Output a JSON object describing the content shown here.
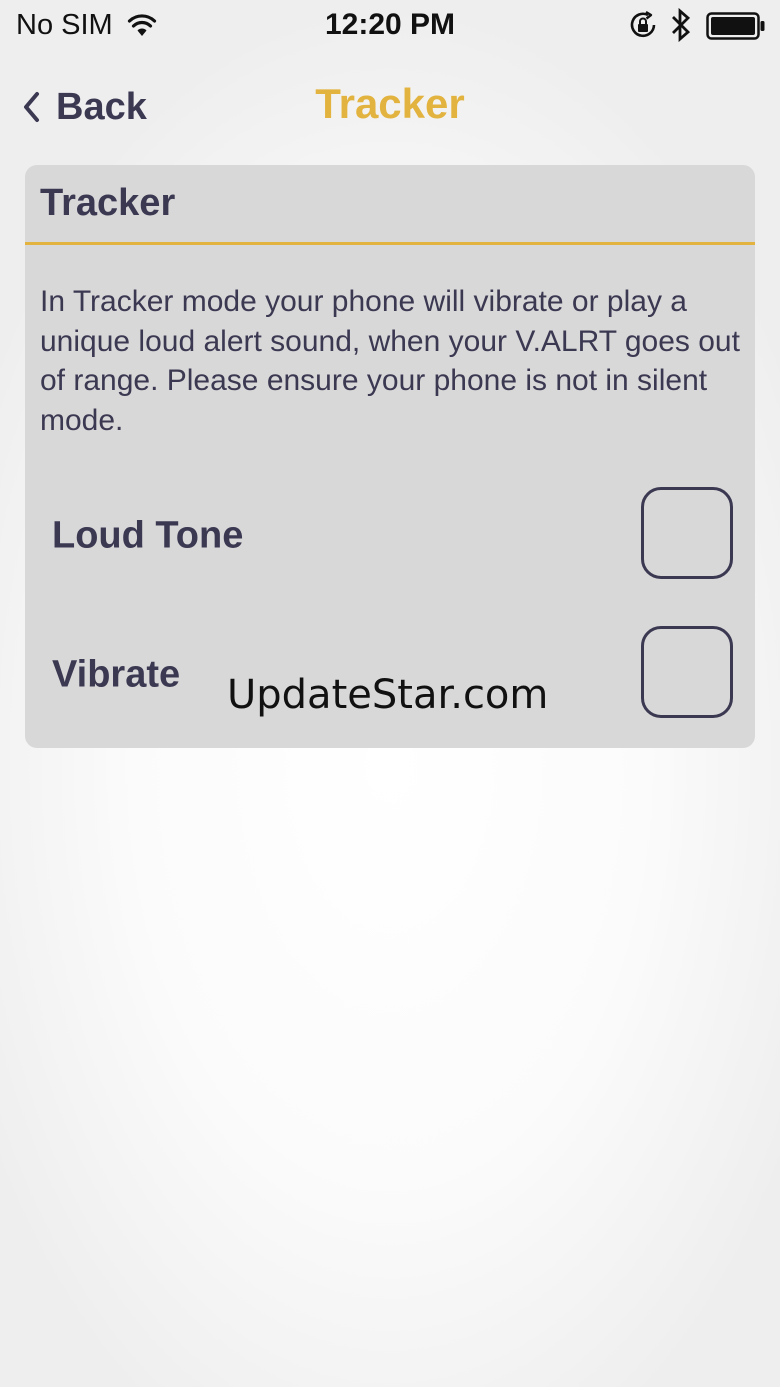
{
  "status_bar": {
    "carrier": "No SIM",
    "time": "12:20 PM"
  },
  "nav": {
    "back_label": "Back",
    "title": "Tracker"
  },
  "card": {
    "title": "Tracker",
    "description": "In Tracker mode your phone will vibrate or play a unique loud alert sound,  when your V.ALRT goes out of range. Please ensure your phone is not in silent mode.",
    "options": [
      {
        "label": "Loud Tone",
        "checked": false
      },
      {
        "label": "Vibrate",
        "checked": false
      }
    ]
  },
  "watermark": "UpdateStar.com",
  "colors": {
    "accent": "#e3b33f",
    "text": "#3b3852",
    "card_bg": "#d8d8d8"
  },
  "icons": [
    "wifi-icon",
    "rotation-lock-icon",
    "bluetooth-icon",
    "battery-icon",
    "chevron-left-icon"
  ]
}
